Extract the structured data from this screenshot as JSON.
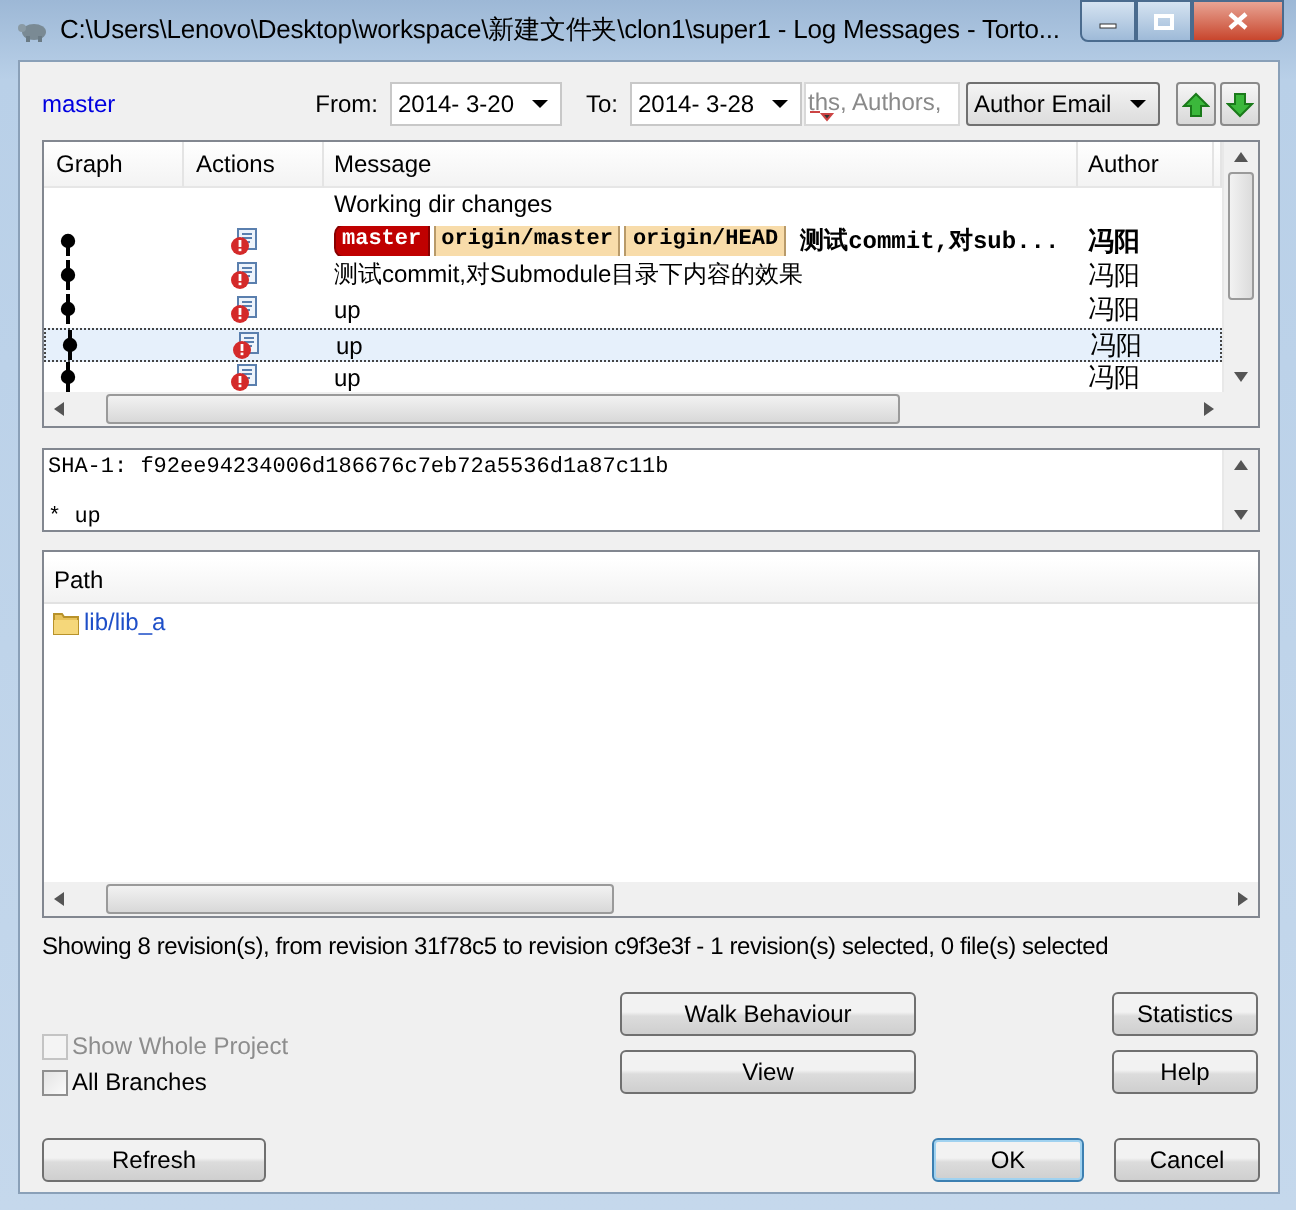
{
  "window": {
    "title": "C:\\Users\\Lenovo\\Desktop\\workspace\\新建文件夹\\clon1\\super1 - Log Messages - Torto..."
  },
  "branch": "master",
  "from": {
    "label": "From:",
    "value": "2014- 3-20"
  },
  "to": {
    "label": "To:",
    "value": "2014- 3-28"
  },
  "search": {
    "placeholder": "ths, Authors,"
  },
  "filter": {
    "value": "Author Email"
  },
  "log": {
    "columns": [
      "Graph",
      "Actions",
      "Message",
      "Author"
    ],
    "rows": [
      {
        "kind": "working",
        "message": "Working dir changes",
        "selected": false
      },
      {
        "kind": "commit",
        "refs": [
          {
            "label": "master",
            "kind": "local"
          },
          {
            "label": "origin/master",
            "kind": "remote"
          },
          {
            "label": "origin/HEAD",
            "kind": "remote"
          }
        ],
        "message": "测试commit,对sub...",
        "author": "冯阳",
        "bold": true,
        "selected": false
      },
      {
        "kind": "commit",
        "message": "测试commit,对Submodule目录下内容的效果",
        "author": "冯阳",
        "bold": false,
        "selected": false
      },
      {
        "kind": "commit",
        "message": "up",
        "author": "冯阳",
        "bold": false,
        "selected": false
      },
      {
        "kind": "commit",
        "message": "up",
        "author": "冯阳",
        "bold": false,
        "selected": true
      },
      {
        "kind": "commit",
        "message": "up",
        "author": "冯阳",
        "bold": false,
        "selected": false
      }
    ]
  },
  "message_box": {
    "lines": [
      "SHA-1: f92ee94234006d186676c7eb72a5536d1a87c11b",
      "* up"
    ]
  },
  "files": {
    "columns": [
      "Path"
    ],
    "rows": [
      {
        "path": "lib/lib_a"
      }
    ]
  },
  "status_bar": "Showing 8 revision(s), from revision 31f78c5 to revision c9f3e3f - 1 revision(s) selected, 0 file(s) selected",
  "checkboxes": [
    {
      "label": "Show Whole Project",
      "checked": false,
      "disabled": true
    },
    {
      "label": "All Branches",
      "checked": false,
      "disabled": false
    }
  ],
  "buttons": {
    "walk": "Walk Behaviour",
    "view": "View",
    "statistics": "Statistics",
    "help": "Help",
    "refresh": "Refresh",
    "ok": "OK",
    "cancel": "Cancel"
  }
}
